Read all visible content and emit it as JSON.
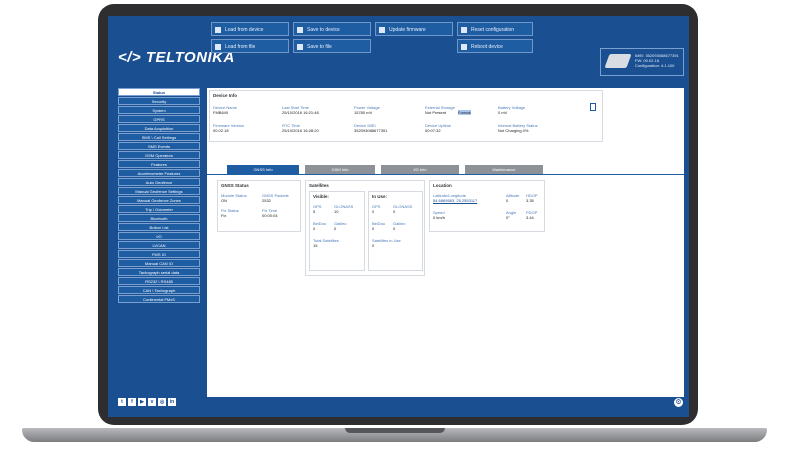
{
  "brand": {
    "logo": "TELTONIKA"
  },
  "toolbar": {
    "load_from_device": "Load from device",
    "save_to_device": "Save to device",
    "update_firmware": "Update firmware",
    "reset_configuration": "Reset configuration",
    "load_from_file": "Load from file",
    "save_to_file": "Save to file",
    "reboot_device": "Reboot device"
  },
  "device": {
    "imei": "IMEI: 352093088677391",
    "fw": "FW: 00.02.18",
    "configuration": "Configuration: 4.1.100"
  },
  "sidebar": {
    "items": [
      {
        "label": "Status"
      },
      {
        "label": "Security"
      },
      {
        "label": "System"
      },
      {
        "label": "GPRS"
      },
      {
        "label": "Data Acquisition"
      },
      {
        "label": "SMS \\ Call Settings"
      },
      {
        "label": "SMS Events"
      },
      {
        "label": "GSM Operators"
      },
      {
        "label": "Features"
      },
      {
        "label": "Accelerometer Features"
      },
      {
        "label": "Auto Geofence"
      },
      {
        "label": "Manual Geofence Settings"
      },
      {
        "label": "Manual Geofence Zones"
      },
      {
        "label": "Trip \\ Odometer"
      },
      {
        "label": "Bluetooth"
      },
      {
        "label": "Button List"
      },
      {
        "label": "I/O"
      },
      {
        "label": "LVCAN"
      },
      {
        "label": "FMS IO"
      },
      {
        "label": "Manual CAN IO"
      },
      {
        "label": "Tachograph serial data"
      },
      {
        "label": "RS232 \\ RS485"
      },
      {
        "label": "CAN \\ Tachograph"
      },
      {
        "label": "Continental FMxS"
      }
    ]
  },
  "device_info": {
    "title": "Device Info",
    "device_name": {
      "label": "Device Name",
      "value": "FMB640"
    },
    "last_start_time": {
      "label": "Last Start Time",
      "value": "25/10/2016 16:21:48"
    },
    "power_voltage": {
      "label": "Power Voltage",
      "value": "15780 mV"
    },
    "external_storage": {
      "label": "External Storage",
      "value": "Not Present",
      "extra": "Format"
    },
    "battery_voltage": {
      "label": "Battery Voltage",
      "value": "0 mV"
    },
    "firmware_version": {
      "label": "Firmware Version",
      "value": "00.02.18"
    },
    "rtc_time": {
      "label": "RTC Time",
      "value": "25/10/2016 16:28:20"
    },
    "device_imei": {
      "label": "Device IMEI",
      "value": "352093088677391"
    },
    "device_uptime": {
      "label": "Device Uptime",
      "value": "00:07:32"
    },
    "internal_battery_status": {
      "label": "Internal Battery Status",
      "value": "Not Charging 0%"
    }
  },
  "tabs": [
    {
      "label": "GNSS Info"
    },
    {
      "label": "GSM Info"
    },
    {
      "label": "I/O Info"
    },
    {
      "label": "Maintenance"
    }
  ],
  "gnss_status": {
    "title": "GNSS Status",
    "module_status": {
      "label": "Module Status",
      "value": "ON"
    },
    "gnss_packets": {
      "label": "GNSS Packets",
      "value": "2532"
    },
    "fix_status": {
      "label": "Fix Status",
      "value": "Fix"
    },
    "fix_time": {
      "label": "Fix Time",
      "value": "00:00:04"
    }
  },
  "satellites": {
    "title": "Satellites",
    "visible_title": "Visible:",
    "in_use_title": "In Use:",
    "gps_label": "GPS",
    "glonass_label": "GLONASS",
    "beidou_label": "BeiDou",
    "galileo_label": "Galileo",
    "visible_gps": "5",
    "visible_glonass": "10",
    "visible_beidou": "0",
    "visible_galileo": "0",
    "inuse_gps": "0",
    "inuse_glonass": "0",
    "inuse_beidou": "0",
    "inuse_galileo": "0",
    "total_label": "Total Satellites",
    "total_value": "15",
    "inuse_total_label": "Satellites in Use",
    "inuse_total_value": "0"
  },
  "location": {
    "title": "Location",
    "latlon": {
      "label": "Latitude/Longitude",
      "value": "54.6869583, 25.2553117"
    },
    "altitude": {
      "label": "Altitude",
      "value": "0"
    },
    "hdop": {
      "label": "HDOP",
      "value": "3.35"
    },
    "speed": {
      "label": "Speed",
      "value": "0 km/h"
    },
    "angle": {
      "label": "Angle",
      "value": "0°"
    },
    "pdop": {
      "label": "PDOP",
      "value": "3.44"
    }
  },
  "social": {
    "icons": [
      "twitter",
      "facebook",
      "youtube",
      "vimeo",
      "instagram",
      "linkedin"
    ]
  }
}
